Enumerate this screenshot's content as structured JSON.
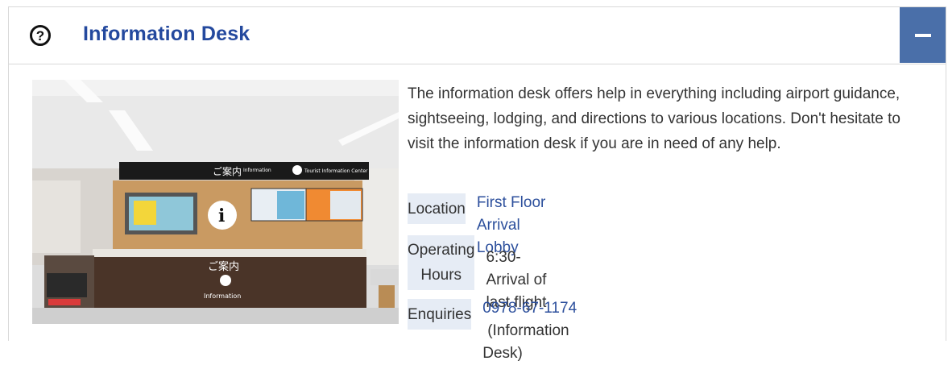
{
  "panel": {
    "title": "Information Desk",
    "help_icon": "question-circle-icon",
    "collapse_icon": "minus-icon",
    "accent_color": "#24499e",
    "button_color": "#4a6fa9"
  },
  "photo": {
    "sign_main": "ご案内",
    "sign_info": "Information",
    "sign_tourist": "Tourist Information Center",
    "counter_jp": "ご案内",
    "counter_en": "Information",
    "info_glyph": "i"
  },
  "description": "The information desk offers help in everything including airport guidance, sightseeing, lodging, and directions to various locations. Don't hesitate to visit the information desk if you are in need of any help.",
  "details": {
    "location_label": "Location",
    "location_value": "First Floor Arrival Lobby",
    "hours_label_line1": "Operating",
    "hours_label_line2": "Hours",
    "hours_value": "6:30-Arrival of last flight",
    "enquiries_label": "Enquiries",
    "enquiries_phone": "0978-67-1174",
    "enquiries_note": "(Information Desk)"
  }
}
